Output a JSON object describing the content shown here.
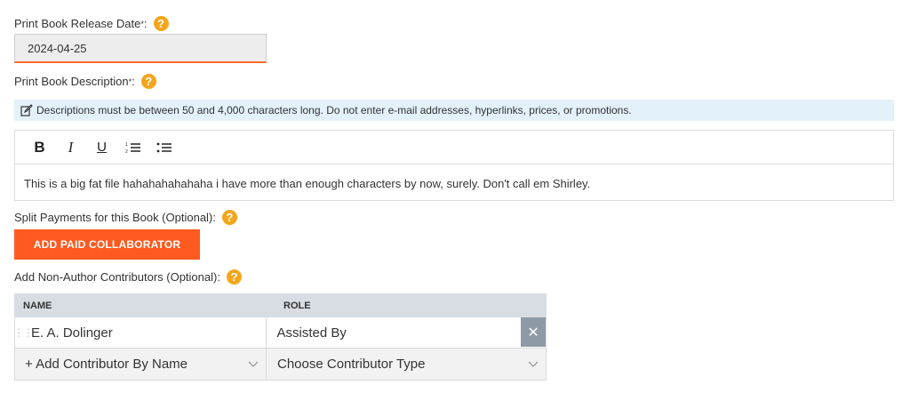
{
  "release_date": {
    "label": "Print Book Release Date",
    "required_mark": "*",
    "value": "2024-04-25"
  },
  "description": {
    "label": "Print Book Description",
    "required_mark": "*",
    "notice": "Descriptions must be between 50 and 4,000 characters long. Do not enter e-mail addresses, hyperlinks, prices, or promotions.",
    "toolbar": {
      "bold": "B",
      "italic": "I",
      "underline": "U"
    },
    "text": "This is a big fat file hahahahahahaha i have more than enough characters by now, surely. Don't call em Shirley."
  },
  "split_payments": {
    "label": "Split Payments for this Book (Optional):",
    "button": "ADD PAID COLLABORATOR"
  },
  "contributors": {
    "label": "Add Non-Author Contributors (Optional):",
    "columns": [
      "NAME",
      "ROLE"
    ],
    "rows": [
      {
        "name": "E. A. Dolinger",
        "role": "Assisted By"
      }
    ],
    "add_name_placeholder": "+ Add Contributor By Name",
    "add_role_placeholder": "Choose Contributor Type"
  },
  "colors": {
    "accent": "#ff5a1f",
    "help": "#f4a51c",
    "info_bg": "#e3f1fb"
  }
}
